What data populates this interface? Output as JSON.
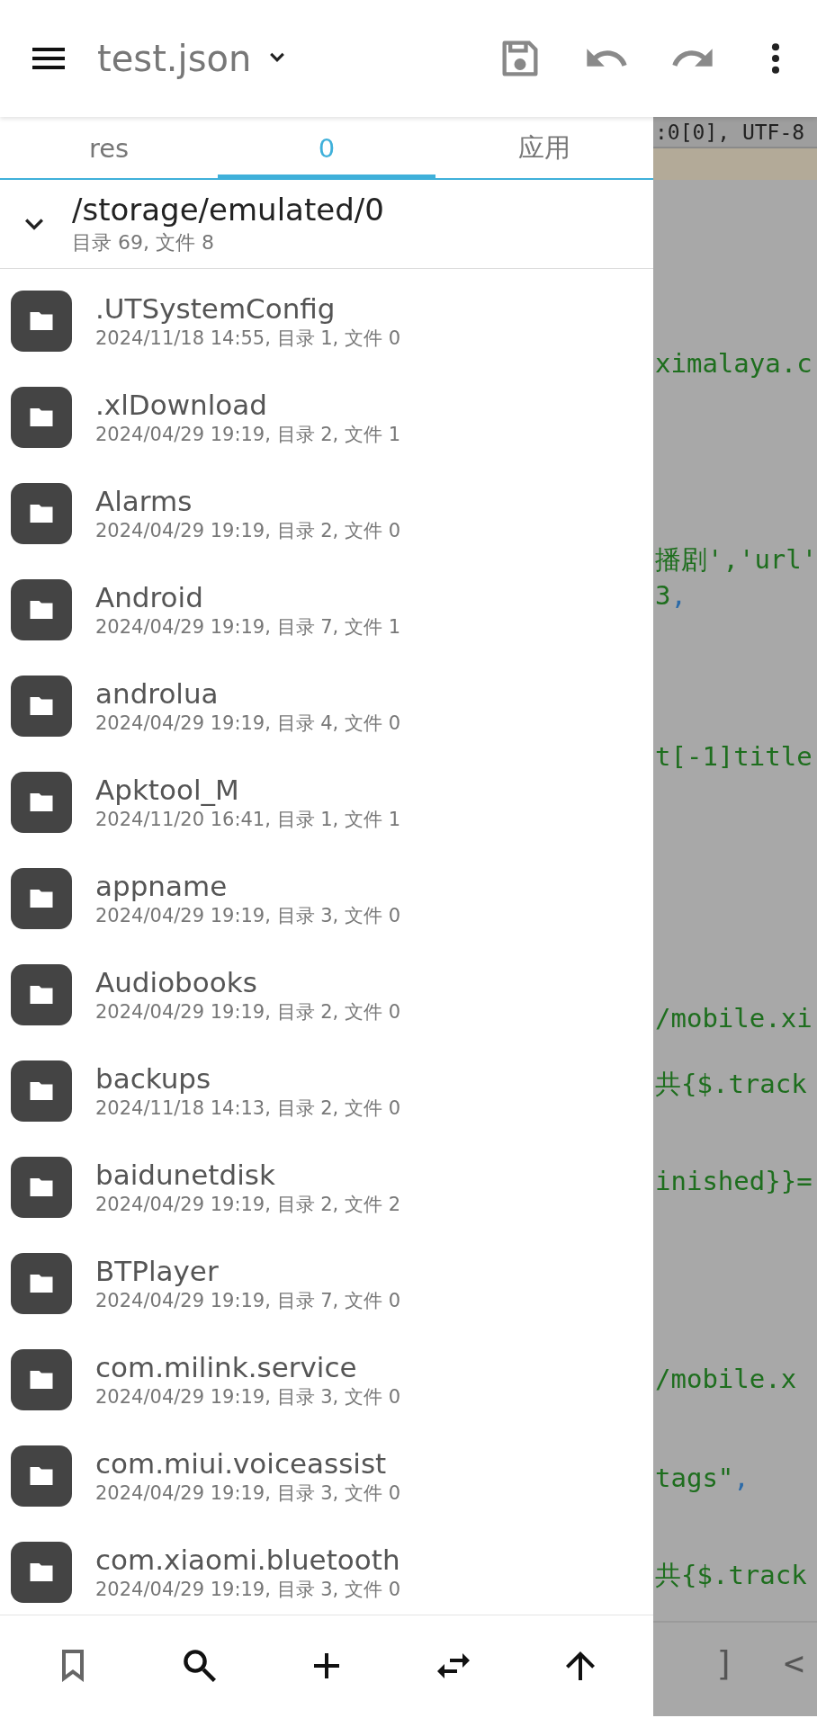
{
  "app_bar": {
    "title": "test.json"
  },
  "drawer": {
    "tabs": [
      {
        "label": "res",
        "selected": false
      },
      {
        "label": "0",
        "selected": true
      },
      {
        "label": "应用",
        "selected": false
      }
    ],
    "path": {
      "title": "/storage/emulated/0",
      "summary": "目录 69, 文件 8",
      "expanded": true
    },
    "folders": [
      {
        "name": ".UTSystemConfig",
        "info": "2024/11/18 14:55, 目录 1, 文件 0"
      },
      {
        "name": ".xlDownload",
        "info": "2024/04/29 19:19, 目录 2, 文件 1"
      },
      {
        "name": "Alarms",
        "info": "2024/04/29 19:19, 目录 2, 文件 0"
      },
      {
        "name": "Android",
        "info": "2024/04/29 19:19, 目录 7, 文件 1"
      },
      {
        "name": "androlua",
        "info": "2024/04/29 19:19, 目录 4, 文件 0"
      },
      {
        "name": "Apktool_M",
        "info": "2024/11/20 16:41, 目录 1, 文件 1"
      },
      {
        "name": "appname",
        "info": "2024/04/29 19:19, 目录 3, 文件 0"
      },
      {
        "name": "Audiobooks",
        "info": "2024/04/29 19:19, 目录 2, 文件 0"
      },
      {
        "name": "backups",
        "info": "2024/11/18 14:13, 目录 2, 文件 0"
      },
      {
        "name": "baidunetdisk",
        "info": "2024/04/29 19:19, 目录 2, 文件 2"
      },
      {
        "name": "BTPlayer",
        "info": "2024/04/29 19:19, 目录 7, 文件 0"
      },
      {
        "name": "com.milink.service",
        "info": "2024/04/29 19:19, 目录 3, 文件 0"
      },
      {
        "name": "com.miui.voiceassist",
        "info": "2024/04/29 19:19, 目录 3, 文件 0"
      },
      {
        "name": "com.xiaomi.bluetooth",
        "info": "2024/04/29 19:19, 目录 3, 文件 0"
      }
    ]
  },
  "editor": {
    "status": ":0[0], UTF-8",
    "lines": [
      [
        {
          "text": "ximalaya.c",
          "kind": "string"
        }
      ],
      [
        {
          "text": "播剧','url'",
          "kind": "string"
        }
      ],
      [
        {
          "text": "3",
          "kind": "string"
        },
        {
          "text": ",",
          "kind": "punct"
        }
      ],
      [
        {
          "text": "t[-1]title",
          "kind": "string"
        }
      ],
      [
        {
          "text": "/mobile.xi",
          "kind": "string"
        }
      ],
      [
        {
          "text": "共{$.track",
          "kind": "string"
        }
      ],
      [
        {
          "text": "inished}}=",
          "kind": "string"
        }
      ],
      [
        {
          "text": "/mobile.x",
          "kind": "string"
        }
      ],
      [
        {
          "text": "tags\"",
          "kind": "string"
        },
        {
          "text": ",",
          "kind": "punct"
        }
      ],
      [
        {
          "text": "共{$.track",
          "kind": "string"
        }
      ]
    ],
    "keys": [
      "]",
      "<"
    ]
  }
}
